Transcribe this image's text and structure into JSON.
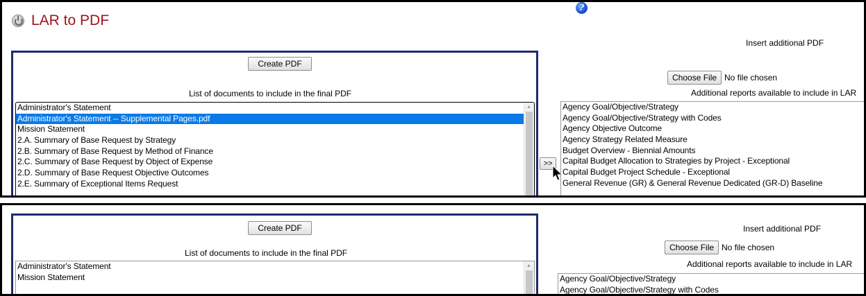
{
  "app": {
    "title": "LAR to PDF"
  },
  "create_pdf_label": "Create PDF",
  "list_caption": "List of documents to include in the final PDF",
  "insert_caption": "Insert additional PDF",
  "choose_file_label": "Choose File",
  "no_file_text": "No file chosen",
  "additional_caption": "Additional reports available to include in LAR",
  "move_button_label": ">>",
  "colors": {
    "title": "#a0151b",
    "panel_border": "#1f2a6b",
    "selection": "#0a7ae8"
  },
  "top": {
    "documents": [
      "Administrator's Statement",
      "Administrator's Statement -- Supplemental Pages.pdf",
      "Mission Statement",
      "2.A. Summary of Base Request by Strategy",
      "2.B. Summary of Base Request by Method of Finance",
      "2.C. Summary of Base Request by Object of Expense",
      "2.D. Summary of Base Request Objective Outcomes",
      "2.E. Summary of Exceptional Items Request"
    ],
    "selected_document": "Administrator's Statement -- Supplemental Pages.pdf",
    "reports": [
      "Agency Goal/Objective/Strategy",
      "Agency Goal/Objective/Strategy with Codes",
      "Agency Objective Outcome",
      "Agency Strategy Related Measure",
      "Budget Overview - Biennial Amounts",
      "Capital Budget Allocation to Strategies by Project - Exceptional",
      "Capital Budget Project Schedule - Exceptional",
      "General Revenue (GR) & General Revenue Dedicated (GR-D) Baseline"
    ]
  },
  "bottom": {
    "documents": [
      "Administrator's Statement",
      "Mission Statement"
    ],
    "reports": [
      "Agency Goal/Objective/Strategy",
      "Agency Goal/Objective/Strategy with Codes"
    ]
  }
}
